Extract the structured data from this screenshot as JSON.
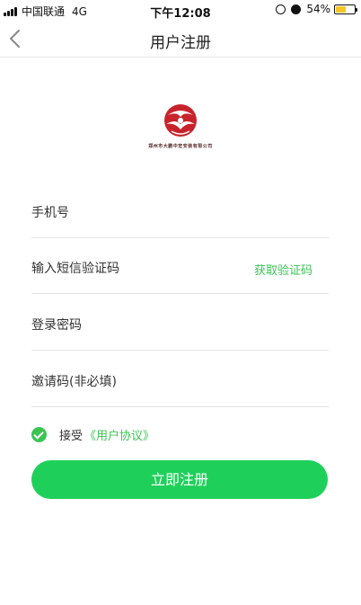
{
  "status_bar": {
    "carrier": "中国联通",
    "network": "4G",
    "time": "下午12:08",
    "battery": "54%",
    "battery_level": 0.54
  },
  "nav": {
    "title": "用户注册"
  },
  "logo": {
    "caption": "郑州市大鹏中宏安装有限公司"
  },
  "form": {
    "phone_placeholder": "手机号",
    "sms_placeholder": "输入短信验证码",
    "get_code_label": "获取验证码",
    "password_placeholder": "登录密码",
    "invite_placeholder": "邀请码(非必填)"
  },
  "agreement": {
    "accept_text": "接受",
    "link_text": "《用户协议》",
    "checked": true
  },
  "submit_label": "立即注册",
  "colors": {
    "accent": "#3bc454",
    "button": "#1ed05a",
    "logo_red": "#c8232c"
  }
}
